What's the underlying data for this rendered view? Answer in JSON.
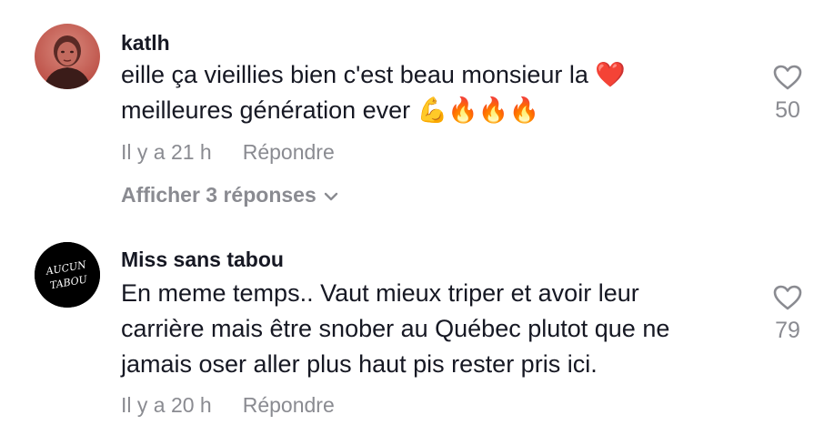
{
  "comments": [
    {
      "username": "katlh",
      "text_line1": "eille ça vieillies bien c'est beau monsieur la ❤️",
      "text_line2": "meilleures génération ever 💪🔥🔥🔥",
      "timestamp": "Il y a 21 h",
      "reply_label": "Répondre",
      "likes": "50",
      "view_replies": "Afficher 3 réponses",
      "avatar_icon": "profile-photo"
    },
    {
      "username": "Miss sans tabou",
      "text_line1": "En meme temps.. Vaut mieux triper et avoir leur",
      "text_line2": "carrière mais être snober au Québec plutot que ne",
      "text_line3": "jamais oser aller plus haut pis rester pris ici.",
      "timestamp": "Il y a 20 h",
      "reply_label": "Répondre",
      "likes": "79",
      "avatar_text_1": "AUCUN",
      "avatar_text_2": "TABOU",
      "avatar_icon": "aucun-tabou-logo"
    }
  ],
  "colors": {
    "primary_text": "#161823",
    "secondary_text": "#8a8b91",
    "icon_gray": "#8a8b91",
    "heart_red": "#e0202c"
  },
  "icons": {
    "like": "heart-outline-icon",
    "expand": "chevron-down-icon"
  }
}
